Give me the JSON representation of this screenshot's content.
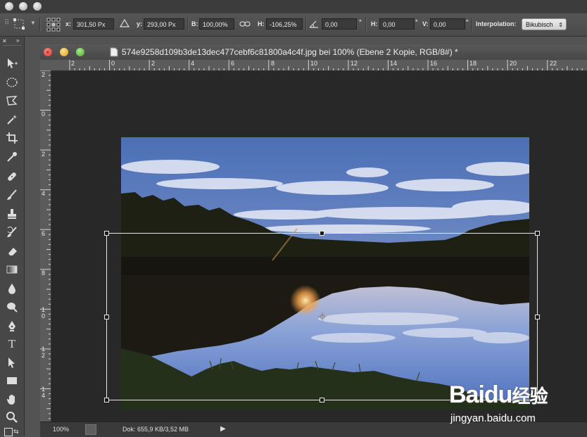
{
  "options_bar": {
    "x_label": "x:",
    "x_value": "301,50 Px",
    "y_label": "y:",
    "y_value": "293,00 Px",
    "w_label": "B:",
    "w_value": "100,00%",
    "h_label": "H:",
    "h_value": "-106,25%",
    "angle_value": "0,00",
    "angle_unit": "°",
    "skew_h_label": "H:",
    "skew_h_value": "0,00",
    "skew_h_unit": "°",
    "skew_v_label": "V:",
    "skew_v_value": "0,00",
    "skew_v_unit": "°",
    "interpolation_label": "Interpolation:",
    "interpolation_value": "Bikubisch"
  },
  "document": {
    "title": "574e9258d109b3de13dec477cebf6c81800a4c4f.jpg bei 100% (Ebene 2 Kopie, RGB/8#) *"
  },
  "ruler_h": [
    "2",
    "0",
    "2",
    "4",
    "6",
    "8",
    "10",
    "12",
    "14",
    "16",
    "18",
    "20",
    "22"
  ],
  "ruler_v": [
    "2",
    "0",
    "2",
    "4",
    "6",
    "8",
    "1\n0",
    "1\n2",
    "1\n4"
  ],
  "status": {
    "zoom": "100%",
    "doc_info": "Dok: 655,9 KB/3,52 MB"
  },
  "watermark": {
    "brand": "Baidu",
    "brand_cn": "经验",
    "url": "jingyan.baidu.com"
  },
  "tools": [
    "move-tool",
    "marquee-tool",
    "lasso-tool",
    "magic-wand-tool",
    "crop-tool",
    "eyedropper-tool",
    "healing-brush-tool",
    "brush-tool",
    "clone-stamp-tool",
    "history-brush-tool",
    "eraser-tool",
    "gradient-tool",
    "blur-tool",
    "dodge-tool",
    "pen-tool",
    "type-tool",
    "path-selection-tool",
    "rectangle-tool",
    "hand-tool",
    "zoom-tool"
  ]
}
